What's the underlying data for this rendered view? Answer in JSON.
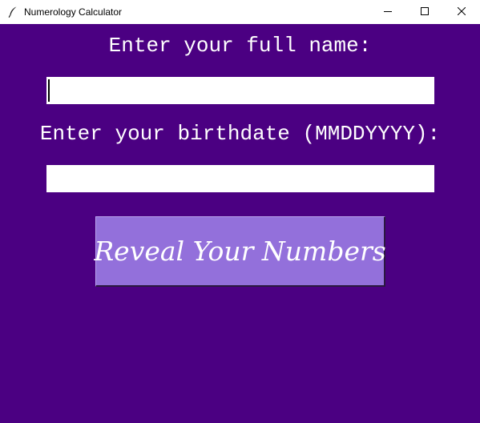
{
  "window": {
    "title": "Numerology Calculator",
    "app_icon": "feather-icon",
    "controls": [
      "minimize-icon",
      "maximize-icon",
      "close-icon"
    ]
  },
  "form": {
    "name_label": "Enter your full name:",
    "name_value": "",
    "birthdate_label": "Enter your birthdate (MMDDYYYY):",
    "birthdate_value": "",
    "reveal_button_label": "Reveal Your Numbers"
  },
  "colors": {
    "background": "#4b0082",
    "button": "#9370db",
    "text": "#ffffff"
  }
}
